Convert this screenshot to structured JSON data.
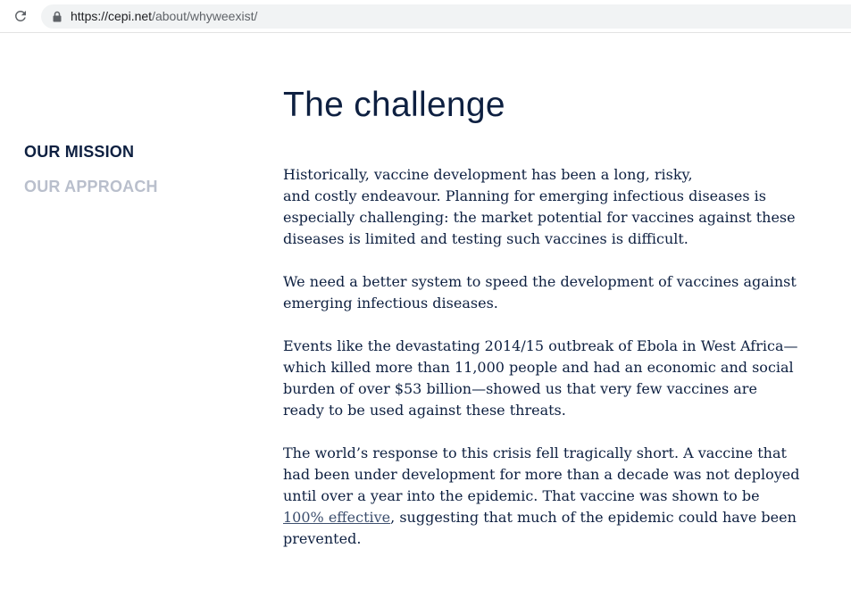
{
  "browser": {
    "url_host": "https://cepi.net",
    "url_path": "/about/whyweexist/"
  },
  "sidenav": {
    "items": [
      {
        "label": "OUR MISSION",
        "active": true
      },
      {
        "label": "OUR APPROACH",
        "active": false
      }
    ]
  },
  "main": {
    "title": "The challenge",
    "paragraphs": [
      {
        "line1": "Historically, vaccine development has been a long, risky,",
        "rest": "and costly endeavour. Planning for emerging infectious diseases is especially challenging: the market potential for vaccines against these diseases is limited and testing such vaccines is difficult."
      },
      {
        "text": "We need a better system to speed the development of vaccines against emerging infectious diseases."
      },
      {
        "text": "Events like the devastating 2014/15 outbreak of Ebola in West Africa—which killed more than 11,000 people and had an economic and social burden of over $53 billion—showed us that very few vaccines are ready to be used against these threats."
      },
      {
        "before": "The world’s response to this crisis fell tragically short.  A vaccine that had been under development for more than a decade was not deployed until over a year into the epidemic. That vaccine was shown to be ",
        "link": "100% effective",
        "after": ", suggesting that much of the epidemic could have been prevented."
      }
    ]
  },
  "colors": {
    "navy": "#0e2041",
    "nav_inactive": "#b9bfcc",
    "omnibox": "#f1f3f4"
  },
  "icons": [
    "reload-icon",
    "lock-icon"
  ]
}
